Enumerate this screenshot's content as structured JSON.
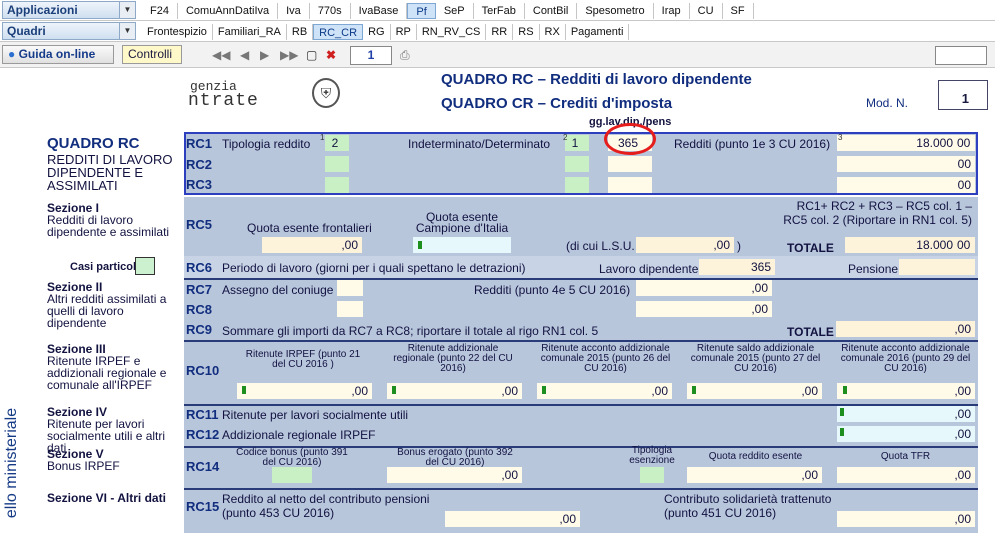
{
  "menu": {
    "applicazioni": "Applicazioni",
    "quadri": "Quadri"
  },
  "tabs1": [
    "F24",
    "ComuAnnDatiIva",
    "Iva",
    "770s",
    "IvaBase",
    "Pf",
    "SeP",
    "TerFab",
    "ContBil",
    "Spesometro",
    "Irap",
    "CU",
    "SF"
  ],
  "tabs2": [
    "Frontespizio",
    "Familiari_RA",
    "RB",
    "RC_CR",
    "RG",
    "RP",
    "RN_RV_CS",
    "RR",
    "RS",
    "RX",
    "Pagamenti"
  ],
  "toolbar": {
    "guida": "Guida on-line",
    "controlli": "Controlli",
    "page": "1"
  },
  "header": {
    "logo1": "genzia",
    "logo2": "ntrate",
    "title1": "QUADRO RC – Redditi di lavoro dipendente",
    "title2": "QUADRO CR – Crediti d'imposta",
    "modn": "Mod. N.",
    "mod_value": "1",
    "gg_label": "gg.lav.dip./pens"
  },
  "rc_section": {
    "title": "QUADRO RC",
    "subtitle": "REDDITI DI LAVORO DIPENDENTE E ASSIMILATI"
  },
  "rc1": {
    "code": "RC1",
    "tipologia": "Tipologia reddito",
    "tip_val": "2",
    "indet": "Indeterminato/Determinato",
    "ind_val": "1",
    "giorni": "365",
    "redditi": "Redditi (punto 1e 3 CU 2016)",
    "red_val": "18.000",
    "cents": "00"
  },
  "rc2": {
    "code": "RC2",
    "cents": "00"
  },
  "rc3": {
    "code": "RC3",
    "cents": "00"
  },
  "sez1": {
    "title": "Sezione I",
    "desc": "Redditi di lavoro dipendente e assimilati"
  },
  "rc5": {
    "code": "RC5",
    "quota_front": "Quota esente frontalieri",
    "quota_camp": "Quota esente Campione d'Italia",
    "dicui": "(di cui L.S.U.",
    "paren": ")",
    "totale": "TOTALE",
    "tot_val": "18.000",
    "note": "RC1+ RC2 + RC3 – RC5 col. 1 – RC5 col. 2 (Riportare in RN1 col. 5)",
    "cents": ",00",
    "cents2": ",00",
    "cents3": "00"
  },
  "casi": "Casi particolari",
  "rc6": {
    "code": "RC6",
    "desc": "Periodo di lavoro (giorni per i quali spettano le detrazioni)",
    "lavdip": "Lavoro dipendente",
    "val": "365",
    "pensione": "Pensione"
  },
  "sez2": {
    "title": "Sezione II",
    "desc": "Altri redditi assimilati a quelli di lavoro dipendente"
  },
  "rc7": {
    "code": "RC7",
    "desc": "Assegno del coniuge",
    "redditi": "Redditi (punto 4e 5 CU 2016)",
    "cents": ",00"
  },
  "rc8": {
    "code": "RC8",
    "cents": ",00"
  },
  "rc9": {
    "code": "RC9",
    "desc": "Sommare gli importi da RC7 a RC8; riportare il totale al rigo RN1 col. 5",
    "totale": "TOTALE",
    "cents": ",00"
  },
  "sez3": {
    "title": "Sezione III",
    "desc": "Ritenute IRPEF e addizionali regionale e comunale all'IRPEF"
  },
  "rc10": {
    "code": "RC10",
    "c1": "Ritenute IRPEF (punto 21 del CU 2016 )",
    "c2": "Ritenute addizionale regionale (punto 22 del CU 2016)",
    "c3": "Ritenute acconto addizionale comunale 2015 (punto 26 del CU 2016)",
    "c4": "Ritenute saldo addizionale comunale 2015 (punto 27 del CU 2016)",
    "c5": "Ritenute acconto addizionale comunale 2016 (punto 29 del CU 2016)",
    "cents": ",00"
  },
  "sez4": {
    "title": "Sezione IV",
    "desc": "Ritenute per lavori socialmente utili e altri dati"
  },
  "rc11": {
    "code": "RC11",
    "desc": "Ritenute per lavori socialmente utili",
    "cents": ",00"
  },
  "rc12": {
    "code": "RC12",
    "desc": "Addizionale regionale IRPEF",
    "cents": ",00"
  },
  "sez5": {
    "title": "Sezione V",
    "desc": "Bonus IRPEF"
  },
  "rc14": {
    "code": "RC14",
    "c1": "Codice bonus (punto 391 del CU 2016)",
    "c2": "Bonus erogato (punto 392 del CU 2016)",
    "c3": "Tipologia esenzione",
    "c4": "Quota reddito esente",
    "c5": "Quota TFR",
    "cents": ",00"
  },
  "sez6": {
    "title": "Sezione VI - Altri dati"
  },
  "rc15": {
    "code": "RC15",
    "desc": "Reddito al netto del contributo pensioni (punto 453 CU 2016)",
    "contrib": "Contributo solidarietà trattenuto (punto 451 CU 2016)",
    "cents": ",00"
  },
  "margin_text": "ello ministeriale"
}
